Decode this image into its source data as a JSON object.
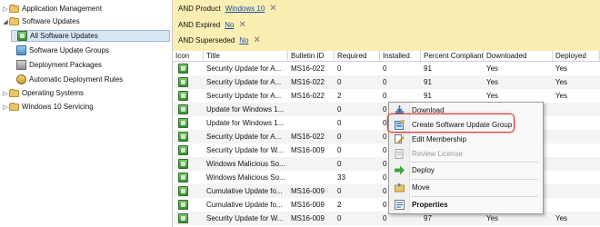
{
  "tree": [
    {
      "label": "Application Management",
      "icon": "folder-icon",
      "expander": "closed"
    },
    {
      "label": "Software Updates",
      "icon": "folder-icon",
      "expander": "open"
    },
    {
      "label": "All Software Updates",
      "icon": "software-updates-icon",
      "expander": "none",
      "selected": true
    },
    {
      "label": "Software Update Groups",
      "icon": "update-group-icon",
      "expander": "none"
    },
    {
      "label": "Deployment Packages",
      "icon": "deployment-package-icon",
      "expander": "none"
    },
    {
      "label": "Automatic Deployment Rules",
      "icon": "deployment-rule-icon",
      "expander": "none"
    },
    {
      "label": "Operating Systems",
      "icon": "folder-icon",
      "expander": "closed"
    },
    {
      "label": "Windows 10 Servicing",
      "icon": "folder-icon",
      "expander": "closed"
    }
  ],
  "criteria": [
    {
      "label": "AND Product",
      "value": "Windows 10"
    },
    {
      "label": "AND Expired",
      "value": "No"
    },
    {
      "label": "AND Superseded",
      "value": "No"
    }
  ],
  "columns": [
    "Icon",
    "Title",
    "Bulletin ID",
    "Required",
    "Installed",
    "Percent Compliant",
    "Downloaded",
    "Deployed"
  ],
  "rows": [
    [
      "",
      "Security Update for A...",
      "MS16-022",
      "0",
      "0",
      "91",
      "Yes",
      "Yes"
    ],
    [
      "",
      "Security Update for A...",
      "MS16-022",
      "0",
      "0",
      "91",
      "Yes",
      "Yes"
    ],
    [
      "",
      "Security Update for A...",
      "MS16-022",
      "2",
      "0",
      "91",
      "Yes",
      "Yes"
    ],
    [
      "",
      "Update for Windows 1...",
      "",
      "0",
      "0",
      "",
      "",
      ""
    ],
    [
      "",
      "Update for Windows 1...",
      "",
      "0",
      "0",
      "",
      "",
      ""
    ],
    [
      "",
      "Security Update for A...",
      "MS16-022",
      "0",
      "0",
      "",
      "",
      ""
    ],
    [
      "",
      "Security Update for W...",
      "MS16-009",
      "0",
      "0",
      "",
      "",
      ""
    ],
    [
      "",
      "Windows Malicious So...",
      "",
      "0",
      "0",
      "",
      "",
      ""
    ],
    [
      "",
      "Windows Malicious So...",
      "",
      "33",
      "0",
      "",
      "",
      ""
    ],
    [
      "",
      "Cumulative Update fo...",
      "MS16-009",
      "0",
      "0",
      "",
      "",
      ""
    ],
    [
      "",
      "Cumulative Update fo...",
      "MS16-009",
      "2",
      "0",
      "",
      "",
      ""
    ],
    [
      "",
      "Security Update for W...",
      "MS16-009",
      "0",
      "0",
      "97",
      "Yes",
      "Yes"
    ]
  ],
  "context_menu": [
    {
      "label": "Download",
      "icon": "download-icon",
      "state": "normal"
    },
    {
      "label": "Create Software Update Group",
      "icon": "create-group-icon",
      "state": "highlighted"
    },
    {
      "label": "Edit Membership",
      "icon": "edit-membership-icon",
      "state": "normal"
    },
    {
      "label": "Review License",
      "icon": "review-license-icon",
      "state": "disabled"
    },
    {
      "label": "Deploy",
      "icon": "deploy-icon",
      "state": "normal"
    },
    {
      "label": "Move",
      "icon": "move-icon",
      "state": "normal"
    },
    {
      "label": "Properties",
      "icon": "properties-icon",
      "state": "bold"
    }
  ],
  "colors": {
    "criteria_bg": "#fbeeb3",
    "link": "#1b4fa3",
    "selection_bg": "#d7e6f5",
    "highlight_border": "#d0362d"
  }
}
